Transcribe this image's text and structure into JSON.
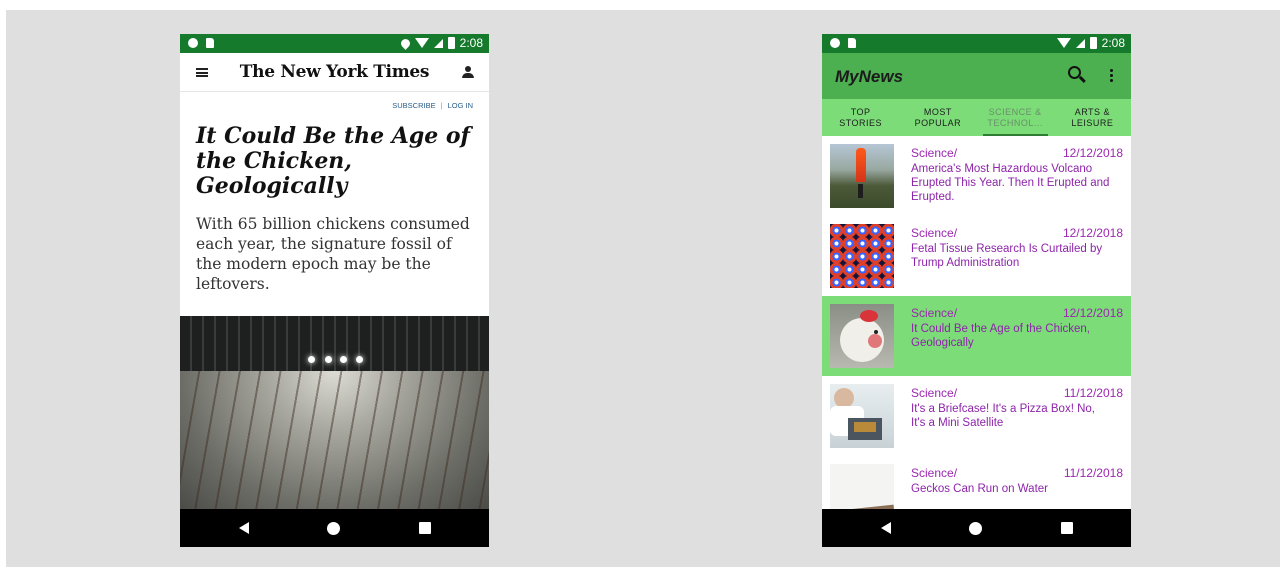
{
  "phones": {
    "left": {
      "status": {
        "time": "2:08"
      },
      "nyt": {
        "logo": "The New York Times",
        "links": {
          "subscribe": "SUBSCRIBE",
          "separator": "|",
          "login": "LOG IN"
        },
        "title": "It Could Be the Age of the Chicken, Geologically",
        "summary": "With 65 billion chickens consumed each year, the signature fossil of the modern epoch may be the leftovers."
      }
    },
    "right": {
      "status": {
        "time": "2:08"
      },
      "app_title": "MyNews",
      "tabs": [
        {
          "line1": "TOP",
          "line2": "STORIES"
        },
        {
          "line1": "MOST",
          "line2": "POPULAR"
        },
        {
          "line1": "SCIENCE &",
          "line2": "TECHNOL..."
        },
        {
          "line1": "ARTS &",
          "line2": "LEISURE"
        }
      ],
      "articles": [
        {
          "section": "Science/",
          "date": "12/12/2018",
          "headline": "America's Most Hazardous Volcano Erupted This Year. Then It Erupted and Erupted."
        },
        {
          "section": "Science/",
          "date": "12/12/2018",
          "headline": "Fetal Tissue Research Is Curtailed by Trump Administration"
        },
        {
          "section": "Science/",
          "date": "12/12/2018",
          "headline": "It Could Be the Age of the Chicken, Geologically",
          "selected": true
        },
        {
          "section": "Science/",
          "date": "11/12/2018",
          "headline": "It's a Briefcase! It's a Pizza Box! No, It's a Mini Satellite"
        },
        {
          "section": "Science/",
          "date": "11/12/2018",
          "headline": "Geckos Can Run on Water"
        }
      ]
    }
  },
  "colors": {
    "status_green": "#157a2c",
    "app_bar_green": "#4caf50",
    "tab_green": "#7bdc78",
    "headline_purple": "#8e24aa"
  }
}
